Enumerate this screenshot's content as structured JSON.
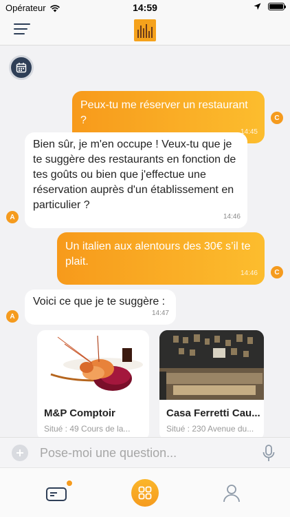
{
  "status_bar": {
    "carrier": "Opérateur",
    "time": "14:59"
  },
  "header": {
    "menu_icon": "hamburger-icon",
    "logo_icon": "app-logo"
  },
  "chat": {
    "calendar_icon": "calendar-icon",
    "messages": [
      {
        "from": "user",
        "avatar": "C",
        "text": "Peux-tu me réserver un restaurant ?",
        "time": "14:45"
      },
      {
        "from": "bot",
        "avatar": "A",
        "text": "Bien sûr, je m'en occupe ! Veux-tu que je te suggère des restaurants en fonction de tes goûts ou bien que j'effectue une réservation auprès d'un établissement en particulier ?",
        "time": "14:46"
      },
      {
        "from": "user",
        "avatar": "C",
        "text": "Un italien aux alentours des 30€ s’il te plait.",
        "time": "14:46"
      },
      {
        "from": "bot",
        "avatar": "A",
        "text": "Voici ce que je te suggère :",
        "time": "14:47"
      }
    ],
    "suggestions": [
      {
        "name": "M&P Comptoir",
        "address": "Situé : 49 Cours de la..."
      },
      {
        "name": "Casa Ferretti Cau...",
        "address": "Situé : 230 Avenue du..."
      }
    ]
  },
  "input_bar": {
    "placeholder": "Pose-moi une question...",
    "value": "",
    "plus_icon": "plus-icon",
    "mic_icon": "microphone-icon"
  },
  "tab_bar": {
    "tabs": [
      {
        "icon": "wallet-icon",
        "has_badge": true
      },
      {
        "icon": "grid-icon",
        "active": true
      },
      {
        "icon": "profile-icon"
      }
    ]
  },
  "colors": {
    "accent": "#f79a1b",
    "accent_light": "#fcbd2e",
    "navy": "#2f3f57",
    "background": "#f2f2f4"
  }
}
